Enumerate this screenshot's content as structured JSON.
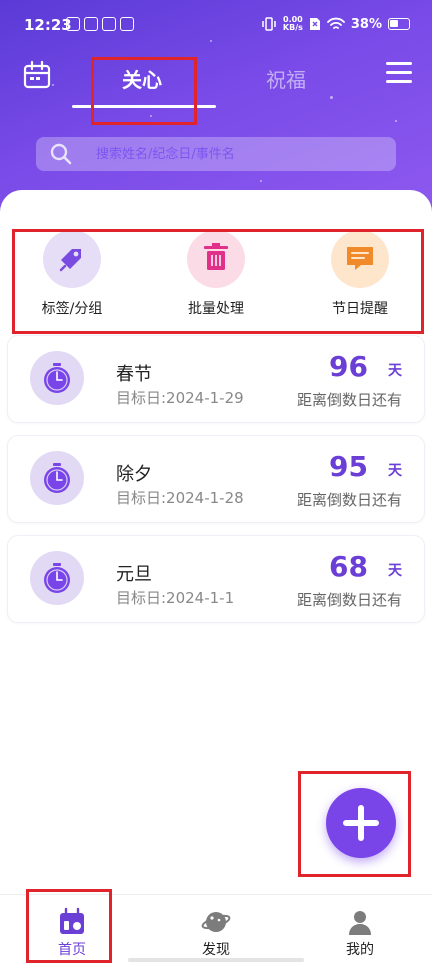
{
  "status_bar": {
    "time": "12:23",
    "net_speed_value": "0.00",
    "net_speed_unit": "KB/s",
    "battery": "38%"
  },
  "header": {
    "tabs": [
      {
        "label": "关心",
        "active": true
      },
      {
        "label": "祝福",
        "active": false
      }
    ]
  },
  "search": {
    "placeholder": "搜索姓名/纪念日/事件名"
  },
  "quick_actions": [
    {
      "label": "标签/分组",
      "icon": "tag-icon",
      "color": "#7a4be0",
      "bg": "#e6ddf7"
    },
    {
      "label": "批量处理",
      "icon": "trash-icon",
      "color": "#e0308a",
      "bg": "#fbdbe6"
    },
    {
      "label": "节日提醒",
      "icon": "message-icon",
      "color": "#f08a2a",
      "bg": "#fde6cc"
    }
  ],
  "events": [
    {
      "name": "春节",
      "date": "目标日:2024-1-29",
      "days": "96",
      "unit": "天",
      "caption": "距离倒数日还有"
    },
    {
      "name": "除夕",
      "date": "目标日:2024-1-28",
      "days": "95",
      "unit": "天",
      "caption": "距离倒数日还有"
    },
    {
      "name": "元旦",
      "date": "目标日:2024-1-1",
      "days": "68",
      "unit": "天",
      "caption": "距离倒数日还有"
    }
  ],
  "bottom_tabs": [
    {
      "label": "首页",
      "icon": "home-calendar-icon",
      "active": true
    },
    {
      "label": "发现",
      "icon": "planet-icon",
      "active": false
    },
    {
      "label": "我的",
      "icon": "user-icon",
      "active": false
    }
  ],
  "colors": {
    "accent": "#6b3fd6",
    "header_gradient_start": "#5a3ad6",
    "header_gradient_end": "#8f5af0",
    "highlight_box": "#e0242c"
  }
}
